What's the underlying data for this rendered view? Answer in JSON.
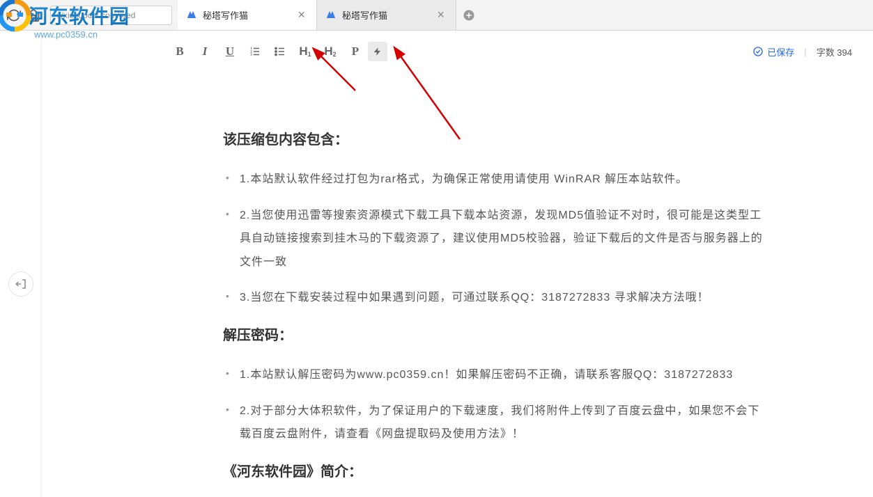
{
  "browser": {
    "url": "://xiezuocat.com/#/ed",
    "tabs": [
      {
        "title": "秘塔写作猫",
        "active": true
      },
      {
        "title": "秘塔写作猫",
        "active": false
      }
    ]
  },
  "watermark": {
    "site_name": "河东软件园",
    "url": "www.pc0359.cn"
  },
  "toolbar": {
    "bold": "B",
    "italic": "I",
    "underline": "U",
    "h1": "H",
    "h1_sub": "1",
    "h2": "H",
    "h2_sub": "2",
    "para": "P"
  },
  "status": {
    "saved_label": "已保存",
    "word_count_label": "字数 394"
  },
  "content": {
    "heading1": "该压缩包内容包含：",
    "list1": [
      "1.本站默认软件经过打包为rar格式，为确保正常使用请使用 WinRAR 解压本站软件。",
      "2.当您使用迅雷等搜索资源模式下载工具下载本站资源，发现MD5值验证不对时，很可能是这类型工具自动链接搜索到挂木马的下载资源了，建议使用MD5校验器，验证下载后的文件是否与服务器上的文件一致",
      "3.当您在下载安装过程中如果遇到问题，可通过联系QQ：3187272833 寻求解决方法哦！"
    ],
    "heading2": "解压密码：",
    "list2": [
      "1.本站默认解压密码为www.pc0359.cn！如果解压密码不正确，请联系客服QQ：3187272833",
      "2.对于部分大体积软件，为了保证用户的下载速度，我们将附件上传到了百度云盘中，如果您不会下载百度云盘附件，请查看《网盘提取码及使用方法》！"
    ],
    "heading3": "《河东软件园》简介："
  }
}
